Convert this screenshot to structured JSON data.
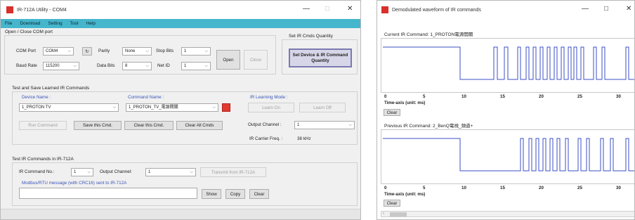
{
  "main": {
    "title": "IR-712A Utility - COM4",
    "menu": [
      "File",
      "Download",
      "Setting",
      "Tool",
      "Help"
    ],
    "open_close": {
      "title": "Open / Close COM port",
      "com_port_label": "COM Port",
      "com_port_value": "COM4",
      "parity_label": "Parity",
      "parity_value": "None",
      "stop_bits_label": "Stop Bits",
      "stop_bits_value": "1",
      "baud_rate_label": "Baud Rate",
      "baud_rate_value": "115200",
      "data_bits_label": "Data Bits",
      "data_bits_value": "8",
      "net_id_label": "Net ID",
      "net_id_value": "1",
      "open_label": "Open",
      "close_label": "Close"
    },
    "set_ir": {
      "title": "Set IR Cmds Quantity",
      "button_label": "Set Device & IR Command Quantity"
    },
    "test_save": {
      "title": "Test and Save Learned IR Commands",
      "device_name_label": "Device Name :",
      "device_name_value": "1_PROTON TV",
      "command_name_label": "Command Name :",
      "command_name_value": "1_PROTON_TV_電源開關",
      "learning_mode_label": "IR Learning Mode :",
      "learn_on_label": "Learn On",
      "learn_off_label": "Learn Off",
      "run_command_label": "Run Command",
      "save_cmd_label": "Save this Cmd.",
      "clear_cmd_label": "Clear this Cmd.",
      "clear_all_label": "Clear All Cmds",
      "output_channel_label": "Output Channel :",
      "output_channel_value": "1",
      "carrier_freq_label": "IR Carrier Freq. :",
      "carrier_freq_value": "38 kHz"
    },
    "test_ir": {
      "title": "Test IR Commands in IR-712A",
      "cmd_no_label": "IR Command No.:",
      "cmd_no_value": "1",
      "output_channel_label": "Output Channel:",
      "output_channel_value": "1",
      "transmit_label": "Transmit from IR-712A",
      "modbus_label": "Modbus/RTU message (with CRC16) sent to IR-712A",
      "modbus_value": "",
      "show_label": "Show",
      "copy_label": "Copy",
      "clear_label": "Clear"
    }
  },
  "wave": {
    "title": "Demodulated waveform of IR commands",
    "current_label": "Current IR Command: 1_PROTON電源開關",
    "previous_label": "Previous IR Command: 2_BenQ電視_頻道+",
    "x_ticks": [
      "0",
      "5",
      "10",
      "15",
      "20",
      "25",
      "30"
    ],
    "axis_title": "Time-axis (unit: ms)",
    "clear_label": "Clear",
    "colors": {
      "wave": "#3b4fc4"
    }
  }
}
